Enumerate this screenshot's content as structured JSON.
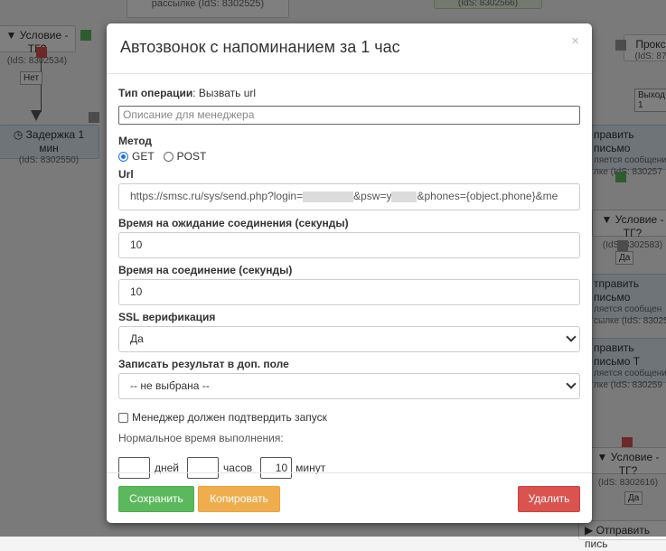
{
  "canvas": {
    "n_mailing": "рассылке (IdS: 8302525)",
    "n_cond1_title": "Условие - ТГ?",
    "n_cond1_id": "(IdS: 8302534)",
    "n_no": "Нет",
    "n_delay_title": "Задержка 1 мин",
    "n_delay_id": "(IdS: 8302550)",
    "n_proxy": "Прокс",
    "n_proxy_id": "(IdS: 87",
    "n_exit": "Выход 1",
    "n_send1": "править письмо",
    "n_send1_b": "ляется сообщени",
    "n_send1_c": "лке (IdS: 830257",
    "n_cond2_title": "Условие - ТГ?",
    "n_cond2_id": "(IdS: 8302583)",
    "n_yes1": "Да",
    "n_send2": "тправить письмо",
    "n_send2_b": "ляется сообщен",
    "n_send2_c": "сылке (IdS: 83025",
    "n_send3": "править письмо Т",
    "n_send3_b": "ляется сообщени",
    "n_send3_c": "лке (IdS: 830259",
    "n_cond3_title": "Условие - ТГ?",
    "n_cond3_id": "(IdS: 8302616)",
    "n_yes2": "Да",
    "n_send4": "Отправить пись",
    "n_top_id": "(IdS: 8302566)"
  },
  "modal": {
    "title": "Автозвонок с напоминанием за 1 час",
    "close_label": "×",
    "op_type_label": "Тип операции",
    "op_type_value": ": Вызвать url",
    "description_placeholder": "Описание для менеджера",
    "method_label": "Метод",
    "method_get": "GET",
    "method_post": "POST",
    "method_selected": "GET",
    "url_label": "Url",
    "url_part1": "https://smsc.ru/sys/send.php?login=",
    "url_part2": "&psw=y",
    "url_part3": "&phones={object.phone}&me",
    "wait_label": "Время на ожидание соединения (секунды)",
    "wait_value": "10",
    "connect_label": "Время на соединение (секунды)",
    "connect_value": "10",
    "ssl_label": "SSL верификация",
    "ssl_value": "Да",
    "result_label": "Записать результат в доп. поле",
    "result_value": "-- не выбрана --",
    "confirm_label": "Менеджер должен подтвердить запуск",
    "confirm_checked": false,
    "normal_time_label": "Нормальное время выполнения:",
    "days_value": "",
    "days_label": "дней",
    "hours_value": "",
    "hours_label": "часов",
    "minutes_value": "10",
    "minutes_label": "минут",
    "save_label": "Сохранить",
    "copy_label": "Копировать",
    "delete_label": "Удалить"
  },
  "colors": {
    "success": "#5cb85c",
    "warning": "#f0ad4e",
    "danger": "#d9534f",
    "radio_accent": "#1a73e8"
  }
}
